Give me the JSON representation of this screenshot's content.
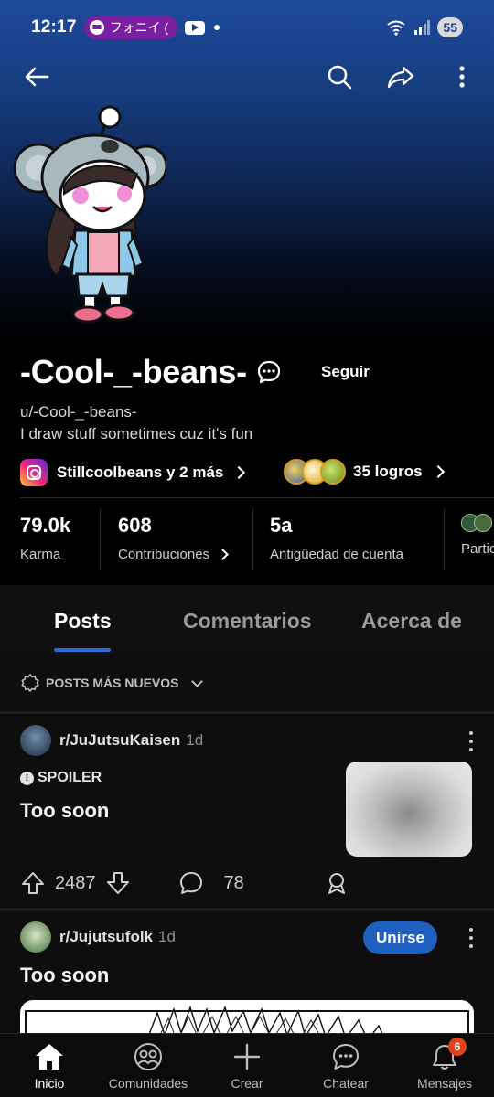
{
  "status_bar": {
    "time": "12:17",
    "media_pill": "フォニイ (",
    "battery": "55"
  },
  "profile": {
    "display_name": "-Cool-_-beans-",
    "follow_label": "Seguir",
    "handle": "u/-Cool-_-beans-",
    "bio": "I draw stuff sometimes cuz it's fun",
    "social_link": "Stillcoolbeans y 2 más",
    "achievements": "35 logros"
  },
  "stats": [
    {
      "value": "79.0k",
      "label": "Karma"
    },
    {
      "value": "608",
      "label": "Contribuciones"
    },
    {
      "value": "5a",
      "label": "Antigüedad de cuenta"
    },
    {
      "value": "",
      "label": "Partic"
    }
  ],
  "tabs": [
    "Posts",
    "Comentarios",
    "Acerca de"
  ],
  "sort": {
    "label": "POSTS MÁS NUEVOS"
  },
  "posts": [
    {
      "subreddit": "r/JuJutsuKaisen",
      "time": "1d",
      "flair": "SPOILER",
      "title": "Too soon",
      "upvotes": "2487",
      "comments": "78"
    },
    {
      "subreddit": "r/Jujutsufolk",
      "time": "1d",
      "join_label": "Unirse",
      "title": "Too soon"
    }
  ],
  "bottom_nav": [
    {
      "label": "Inicio"
    },
    {
      "label": "Comunidades"
    },
    {
      "label": "Crear"
    },
    {
      "label": "Chatear"
    },
    {
      "label": "Mensajes",
      "badge": "6"
    }
  ],
  "colors": {
    "accent": "#2b6bd9",
    "join": "#1f5fbf",
    "badge": "#e2431a",
    "banner": "#1e4a9c"
  }
}
